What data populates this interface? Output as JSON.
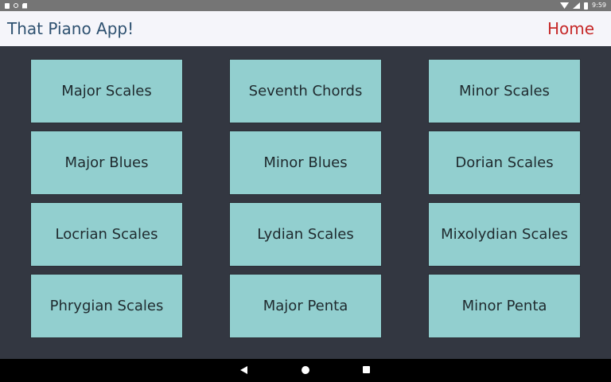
{
  "status_bar": {
    "time": "9:59",
    "icons_left": [
      "notification-square-icon",
      "sync-circle-icon",
      "sd-card-icon"
    ],
    "icons_right": [
      "wifi-icon",
      "cell-signal-icon",
      "battery-icon"
    ]
  },
  "header": {
    "title": "That Piano App!",
    "home_label": "Home"
  },
  "buttons": [
    "Major Scales",
    "Seventh Chords",
    "Minor Scales",
    "Major Blues",
    "Minor Blues",
    "Dorian Scales",
    "Locrian Scales",
    "Lydian Scales",
    "Mixolydian Scales",
    "Phrygian Scales",
    "Major Penta",
    "Minor Penta"
  ],
  "nav_bar": {
    "icons": [
      "back-icon",
      "home-circle-icon",
      "recents-icon"
    ]
  },
  "colors": {
    "background": "#333741",
    "button_fill": "#92cfcf",
    "header_bg": "#f5f5fa",
    "title_color": "#2e5170",
    "home_color": "#c62828"
  }
}
